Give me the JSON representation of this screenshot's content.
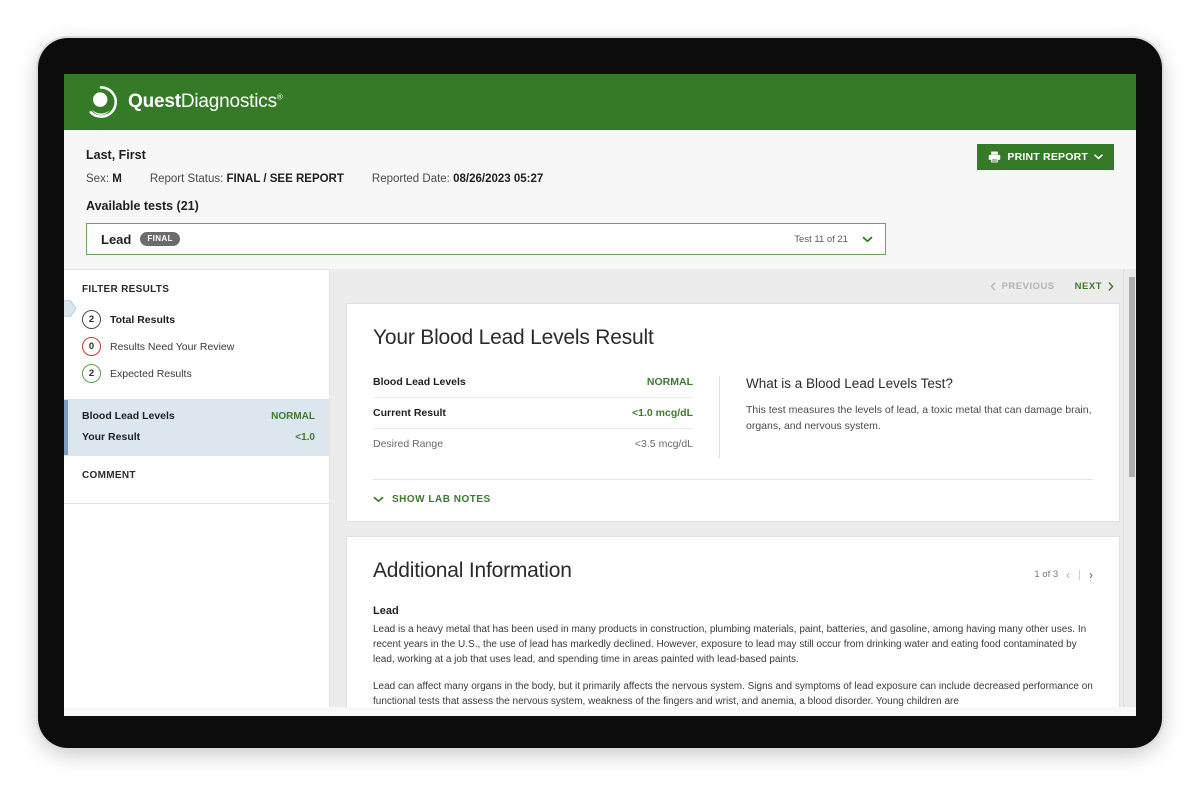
{
  "brand": {
    "name_bold": "Quest",
    "name_light": "Diagnostics",
    "registered": "®",
    "green": "#357a26"
  },
  "patient": {
    "name": "Last, First",
    "sex_label": "Sex:",
    "sex_value": "M",
    "report_status_label": "Report Status:",
    "report_status_value": "FINAL / SEE REPORT",
    "reported_date_label": "Reported Date:",
    "reported_date_value": "08/26/2023 05:27"
  },
  "toolbar": {
    "print_label": "PRINT REPORT"
  },
  "tests": {
    "available_heading": "Available tests (21)",
    "selected_name": "Lead",
    "selected_status": "FINAL",
    "counter": "Test 11 of 21"
  },
  "sidebar": {
    "filter_title": "FILTER RESULTS",
    "filters": [
      {
        "count": "2",
        "label": "Total Results",
        "tone": "dark",
        "active": true
      },
      {
        "count": "0",
        "label": "Results Need Your Review",
        "tone": "red",
        "active": false
      },
      {
        "count": "2",
        "label": "Expected Results",
        "tone": "green",
        "active": false
      }
    ],
    "result_card": {
      "test_label": "Blood Lead Levels",
      "test_status": "NORMAL",
      "result_label": "Your Result",
      "result_value": "<1.0"
    },
    "comment_title": "COMMENT"
  },
  "nav": {
    "previous": "PREVIOUS",
    "next": "NEXT"
  },
  "result_card": {
    "title": "Your Blood Lead Levels Result",
    "rows": [
      {
        "key": "Blood Lead Levels",
        "value": "NORMAL",
        "muted": false
      },
      {
        "key": "Current Result",
        "value": "<1.0 mcg/dL",
        "muted": false
      },
      {
        "key": "Desired Range",
        "value": "<3.5 mcg/dL",
        "muted": true
      }
    ],
    "info_heading": "What is a Blood Lead Levels Test?",
    "info_body": "This test measures the levels of lead, a toxic metal that can damage brain, organs, and nervous system.",
    "lab_notes_label": "SHOW LAB NOTES"
  },
  "additional_info": {
    "title": "Additional Information",
    "pager_text": "1 of 3",
    "subheading": "Lead",
    "paragraphs": [
      "Lead is a heavy metal that has been used in many products in construction, plumbing materials, paint, batteries, and gasoline, among having many other uses. In recent years in the U.S., the use of lead has markedly declined. However, exposure to lead may still occur from drinking water and eating food contaminated by lead, working at a job that uses lead, and spending time in areas painted with lead-based paints.",
      "Lead can affect many organs in the body, but it primarily affects the nervous system. Signs and symptoms of lead exposure can include decreased performance on functional tests that assess the nervous system, weakness of the fingers and wrist, and anemia, a blood disorder. Young children are"
    ]
  }
}
